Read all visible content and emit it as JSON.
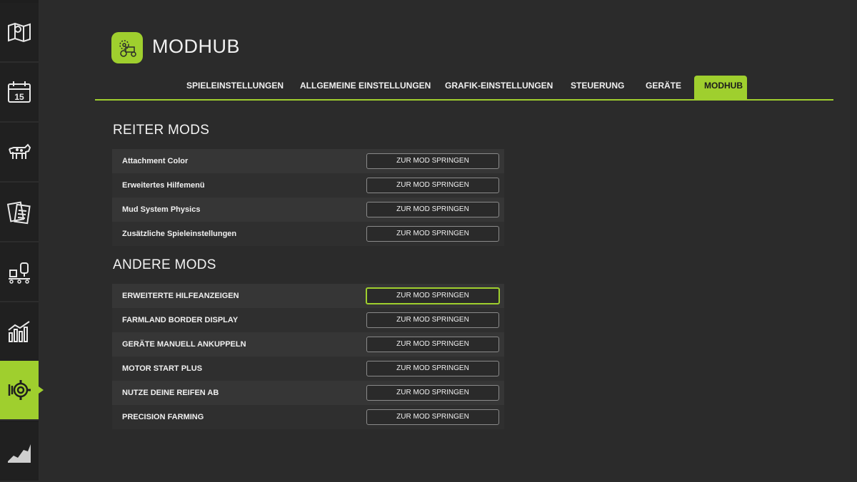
{
  "header": {
    "title": "MODHUB"
  },
  "tabs": [
    {
      "label": "SPIELEINSTELLUNGEN",
      "active": false
    },
    {
      "label": "ALLGEMEINE EINSTELLUNGEN",
      "active": false
    },
    {
      "label": "GRAFIK-EINSTELLUNGEN",
      "active": false
    },
    {
      "label": "STEUERUNG",
      "active": false
    },
    {
      "label": "GERÄTE",
      "active": false
    },
    {
      "label": "MODHUB",
      "active": true
    }
  ],
  "sidebar": {
    "items": [
      {
        "icon": "map-icon",
        "active": false
      },
      {
        "icon": "calendar-icon",
        "label": "15",
        "active": false
      },
      {
        "icon": "cow-icon",
        "active": false
      },
      {
        "icon": "contracts-icon",
        "active": false
      },
      {
        "icon": "production-icon",
        "active": false
      },
      {
        "icon": "statistics-icon",
        "active": false
      },
      {
        "icon": "settings-gear-icon",
        "active": true
      },
      {
        "icon": "prices-chart-icon",
        "active": false
      }
    ]
  },
  "sections": [
    {
      "title": "REITER MODS",
      "rows": [
        {
          "name": "Attachment Color",
          "button": "ZUR MOD SPRINGEN"
        },
        {
          "name": "Erweitertes Hilfemenü",
          "button": "ZUR MOD SPRINGEN"
        },
        {
          "name": "Mud System Physics",
          "button": "ZUR MOD SPRINGEN"
        },
        {
          "name": "Zusätzliche Spieleinstellungen",
          "button": "ZUR MOD SPRINGEN"
        }
      ]
    },
    {
      "title": "ANDERE MODS",
      "rows": [
        {
          "name": "ERWEITERTE HILFEANZEIGEN",
          "button": "ZUR MOD SPRINGEN",
          "focused": true
        },
        {
          "name": "FARMLAND BORDER DISPLAY",
          "button": "ZUR MOD SPRINGEN"
        },
        {
          "name": "GERÄTE MANUELL ANKUPPELN",
          "button": "ZUR MOD SPRINGEN"
        },
        {
          "name": "MOTOR START PLUS",
          "button": "ZUR MOD SPRINGEN"
        },
        {
          "name": "NUTZE DEINE REIFEN AB",
          "button": "ZUR MOD SPRINGEN"
        },
        {
          "name": "PRECISION FARMING",
          "button": "ZUR MOD SPRINGEN"
        }
      ]
    }
  ],
  "colors": {
    "accent": "#9fcf2e",
    "background": "#2b2b2b",
    "sidebar": "#1e1e1e"
  }
}
